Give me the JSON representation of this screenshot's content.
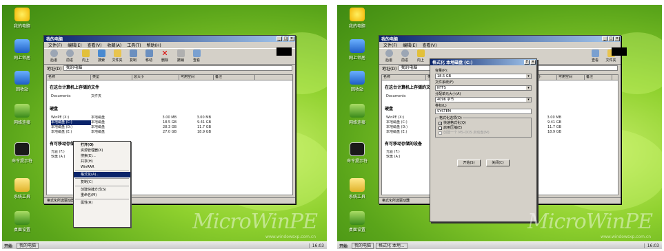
{
  "left_panel": {
    "desktop_icons": [
      "我的电脑",
      "网上邻居",
      "回收站",
      "网络连接",
      "命令提示符",
      "系统工具",
      "桌面设置"
    ],
    "window": {
      "title": "我的电脑",
      "menu": [
        "文件(F)",
        "编辑(E)",
        "查看(V)",
        "收藏(A)",
        "工具(T)",
        "帮助(H)"
      ],
      "toolbar": [
        "后退",
        "前进",
        "向上",
        "搜索",
        "文件夹",
        "复制",
        "移动",
        "删除",
        "撤销",
        "查看"
      ],
      "address_label": "地址(D)",
      "address_value": "我的电脑",
      "columns": [
        "名称",
        "类型",
        "总大小",
        "可用空间",
        "备注"
      ],
      "group_files": "在这台计算机上存储的文件",
      "documents_name": "Documents",
      "documents_type": "文件夹",
      "group_drives": "硬盘",
      "drives": [
        {
          "name": "WinPE (X:)",
          "type": "本地磁盘",
          "total": "3.00 MB",
          "free": "3.00 MB"
        },
        {
          "name": "本地磁盘 (C:)",
          "type": "本地磁盘",
          "total": "18.5 GB",
          "free": "9.41 GB"
        },
        {
          "name": "本地磁盘 (D:)",
          "type": "本地磁盘",
          "total": "28.3 GB",
          "free": "11.7 GB"
        },
        {
          "name": "本地磁盘 (E:)",
          "type": "本地磁盘",
          "total": "27.0 GB",
          "free": "18.9 GB"
        }
      ],
      "group_removable": "有可移动存储的设备",
      "removable": [
        "光驱 (F:)",
        "软盘 (A:)"
      ],
      "status": "格式化所选驱动器"
    },
    "context_menu": [
      "打开(O)",
      "资源管理器(X)",
      "搜索(E)...",
      "共享(H)",
      "WinRAR",
      "格式化(A)...",
      "复制(C)",
      "创建快捷方式(S)",
      "重命名(M)",
      "属性(R)"
    ],
    "taskbar": {
      "start": "开始",
      "task": "我的电脑",
      "clock": "16:03"
    }
  },
  "right_panel": {
    "dialog": {
      "title": "格式化 本地磁盘 (C:)",
      "capacity_label": "容量(P):",
      "capacity_value": "18.5 GB",
      "fs_label": "文件系统(F)",
      "fs_value": "NTFS",
      "alloc_label": "分配单元大小(A)",
      "alloc_value": "4096 字节",
      "vol_label": "卷标(L)",
      "vol_value": "SYSTEM",
      "options_label": "格式化选项(O)",
      "opt_quick": "快速格式化(Q)",
      "opt_compress": "启用压缩(E)",
      "opt_dos": "创建一个 MS-DOS 启动盘(M)",
      "start_btn": "开始(S)",
      "close_btn": "关闭(C)"
    },
    "taskbar": {
      "start": "开始",
      "task1": "我的电脑",
      "task2": "格式化 本地...",
      "clock": "16:03"
    }
  },
  "watermark": "MicroWinPE",
  "watermark_sub": "www.windowsxp.com.cn"
}
